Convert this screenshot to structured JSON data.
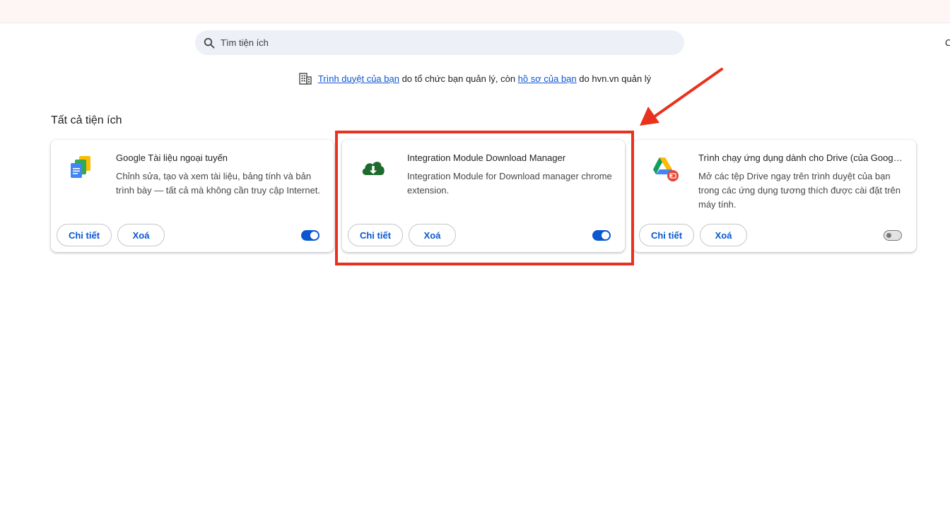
{
  "search": {
    "placeholder": "Tìm tiện ích"
  },
  "right_edge_text": "C",
  "managed_notice": {
    "link1": "Trình duyệt của bạn",
    "text1": " do tổ chức bạn quản lý, còn ",
    "link2": "hồ sơ của bạn",
    "text2": " do hvn.vn quản lý"
  },
  "section_title": "Tất cả tiện ích",
  "extensions": [
    {
      "name": "Google Tài liệu ngoại tuyến",
      "description": "Chỉnh sửa, tạo và xem tài liệu, bảng tính và bản trình bày — tất cả mà không cần truy cập Internet.",
      "details_label": "Chi tiết",
      "remove_label": "Xoá",
      "enabled": true
    },
    {
      "name": "Integration Module Download Manager",
      "description": "Integration Module for Download manager chrome extension.",
      "details_label": "Chi tiết",
      "remove_label": "Xoá",
      "enabled": true
    },
    {
      "name": "Trình chạy ứng dụng dành cho Drive (của Google)",
      "description": "Mở các tệp Drive ngay trên trình duyệt của bạn trong các ứng dụng tương thích được cài đặt trên máy tính.",
      "details_label": "Chi tiết",
      "remove_label": "Xoá",
      "enabled": false
    }
  ],
  "colors": {
    "accent": "#0b57d0",
    "annotation": "#e8321e"
  }
}
